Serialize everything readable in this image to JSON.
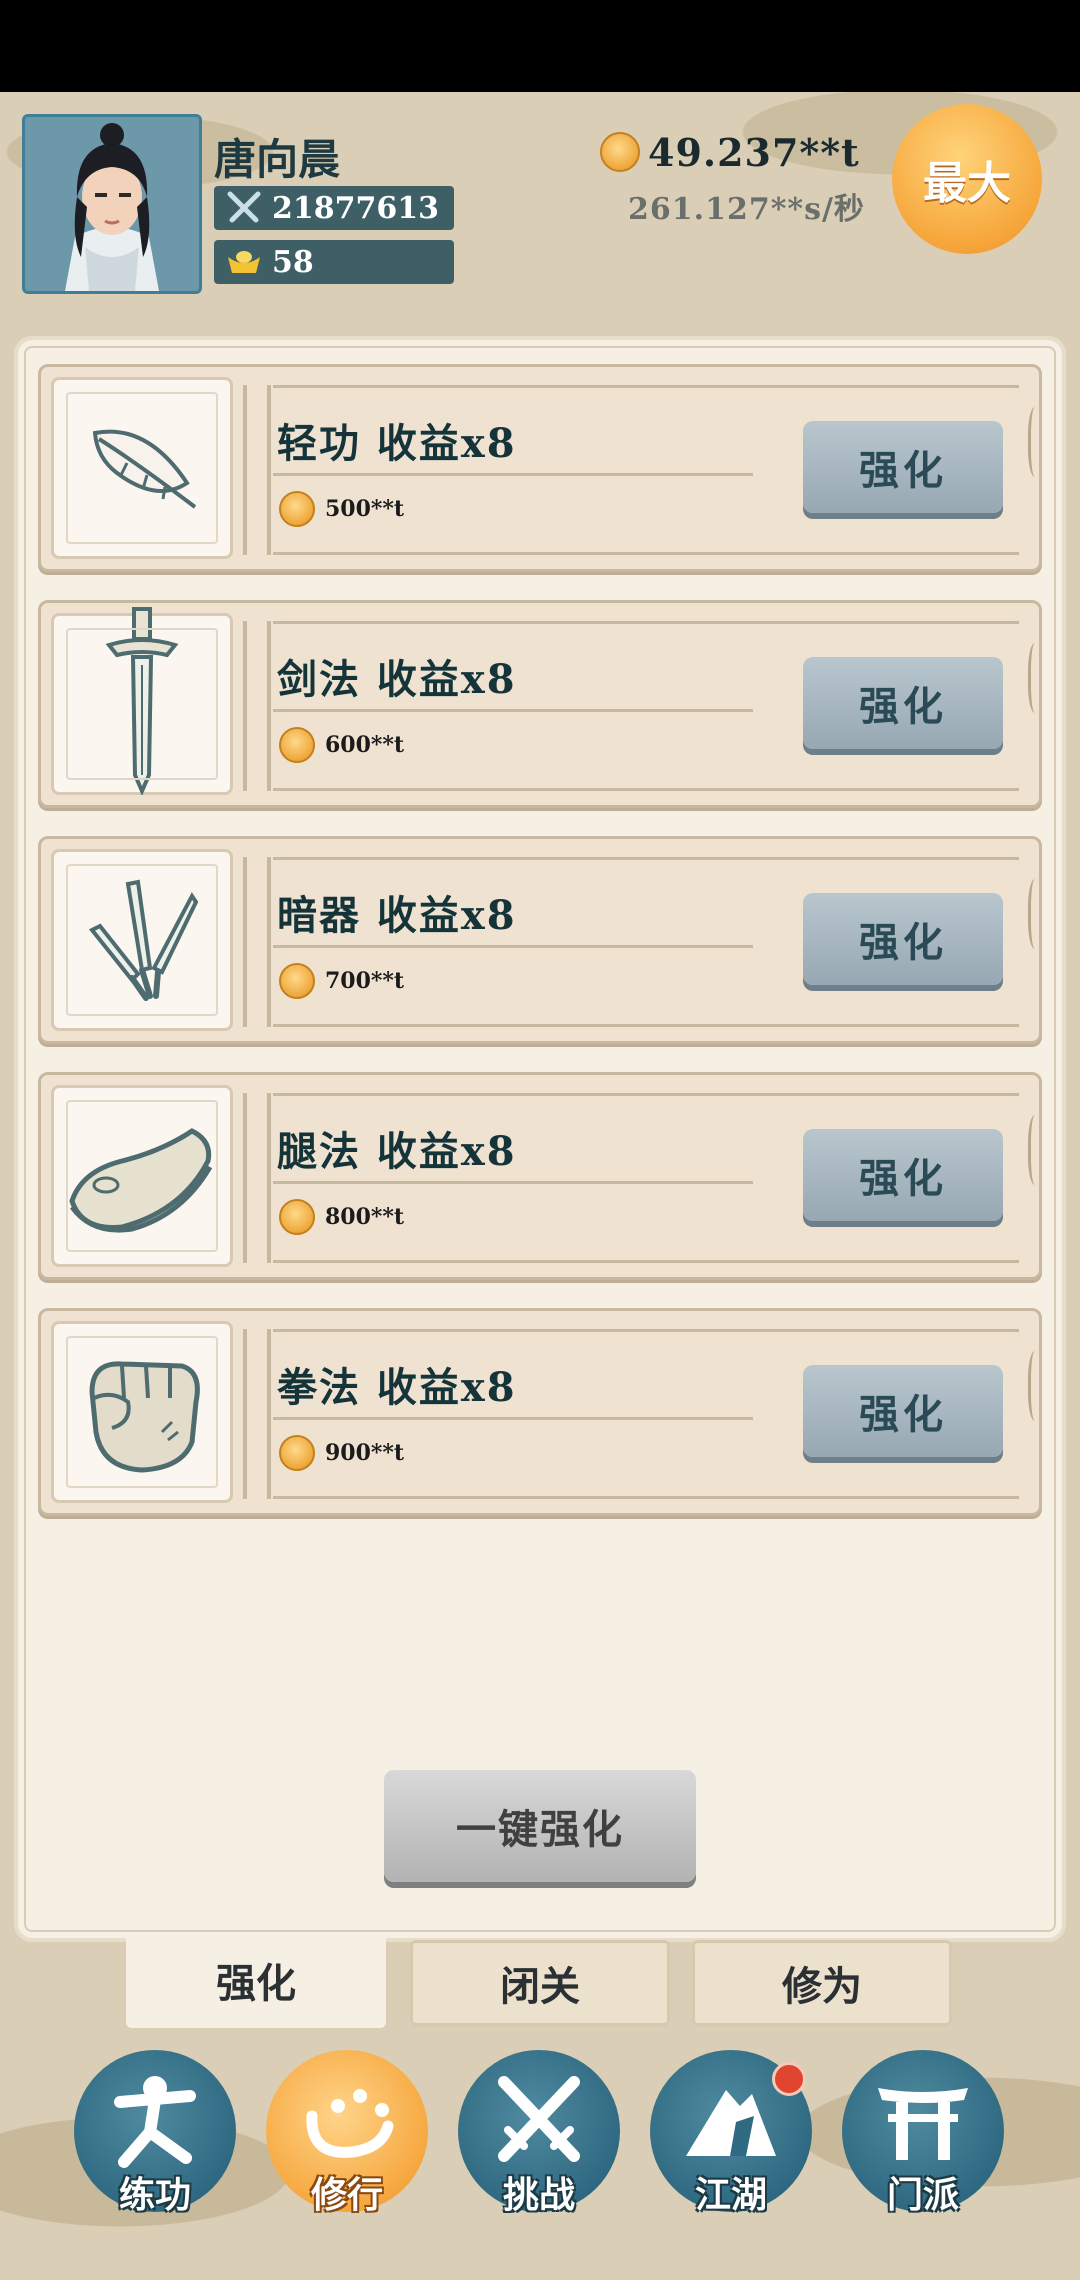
{
  "player": {
    "name": "唐向晨",
    "power": "21877613",
    "gold_ingots": "58"
  },
  "currency": {
    "coins_total": "49.237**t",
    "coins_rate": "261.127**s/秒",
    "max_label": "最大"
  },
  "upgrades": [
    {
      "icon": "feather-icon",
      "title": "轻功 收益x8",
      "cost": "500**t",
      "button": "强化"
    },
    {
      "icon": "sword-icon",
      "title": "剑法 收益x8",
      "cost": "600**t",
      "button": "强化"
    },
    {
      "icon": "darts-icon",
      "title": "暗器 收益x8",
      "cost": "700**t",
      "button": "强化"
    },
    {
      "icon": "shoe-icon",
      "title": "腿法 收益x8",
      "cost": "800**t",
      "button": "强化"
    },
    {
      "icon": "fist-icon",
      "title": "拳法 收益x8",
      "cost": "900**t",
      "button": "强化"
    }
  ],
  "one_key_button": "一键强化",
  "subtabs": [
    {
      "label": "强化",
      "active": true
    },
    {
      "label": "闭关",
      "active": false
    },
    {
      "label": "修为",
      "active": false
    }
  ],
  "nav": [
    {
      "label": "练功",
      "icon": "training-icon",
      "active": false
    },
    {
      "label": "修行",
      "icon": "heart-mind-icon",
      "active": true
    },
    {
      "label": "挑战",
      "icon": "crossed-swords-icon",
      "active": false
    },
    {
      "label": "江湖",
      "icon": "mountain-icon",
      "active": false,
      "badge": true
    },
    {
      "label": "门派",
      "icon": "gate-icon",
      "active": false
    }
  ],
  "colors": {
    "accent_orange": "#f6a63a",
    "nav_teal": "#2f6a82",
    "button_steel": "#a7b6bf"
  }
}
